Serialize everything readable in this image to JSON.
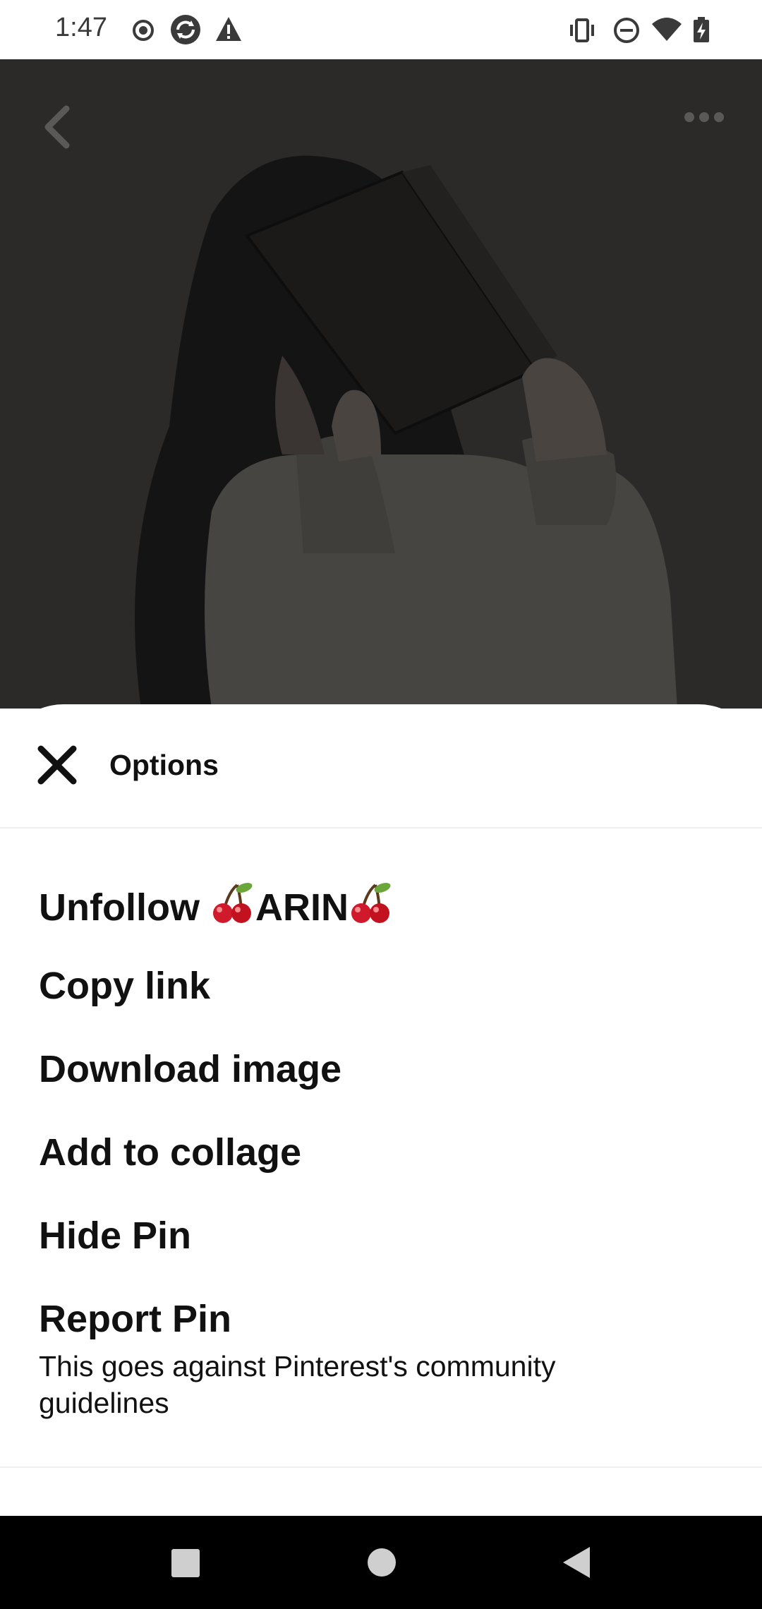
{
  "status_bar": {
    "time": "1:47",
    "icons": [
      "record-icon",
      "sync-icon",
      "warning-icon",
      "vibrate-icon",
      "do-not-disturb-icon",
      "wifi-icon",
      "battery-charging-icon"
    ]
  },
  "pin": {
    "back_icon": "chevron-left-icon",
    "more_icon": "more-horizontal-icon"
  },
  "sheet": {
    "title": "Options",
    "close_icon": "close-icon",
    "options": [
      {
        "label_prefix": "Unfollow ",
        "label_name": "ARIN",
        "emoji": "cherry"
      },
      {
        "label": "Copy link"
      },
      {
        "label": "Download image"
      },
      {
        "label": "Add to collage"
      },
      {
        "label": "Hide Pin"
      },
      {
        "label": "Report Pin",
        "sublabel": "This goes against Pinterest's community guidelines"
      }
    ]
  },
  "nav_bar": {
    "buttons": [
      "recents-square-icon",
      "home-circle-icon",
      "back-triangle-icon"
    ]
  },
  "colors": {
    "sheet_bg": "#ffffff",
    "text": "#111111",
    "overlay_bg": "#2b2a28",
    "nav_bg": "#000000"
  }
}
